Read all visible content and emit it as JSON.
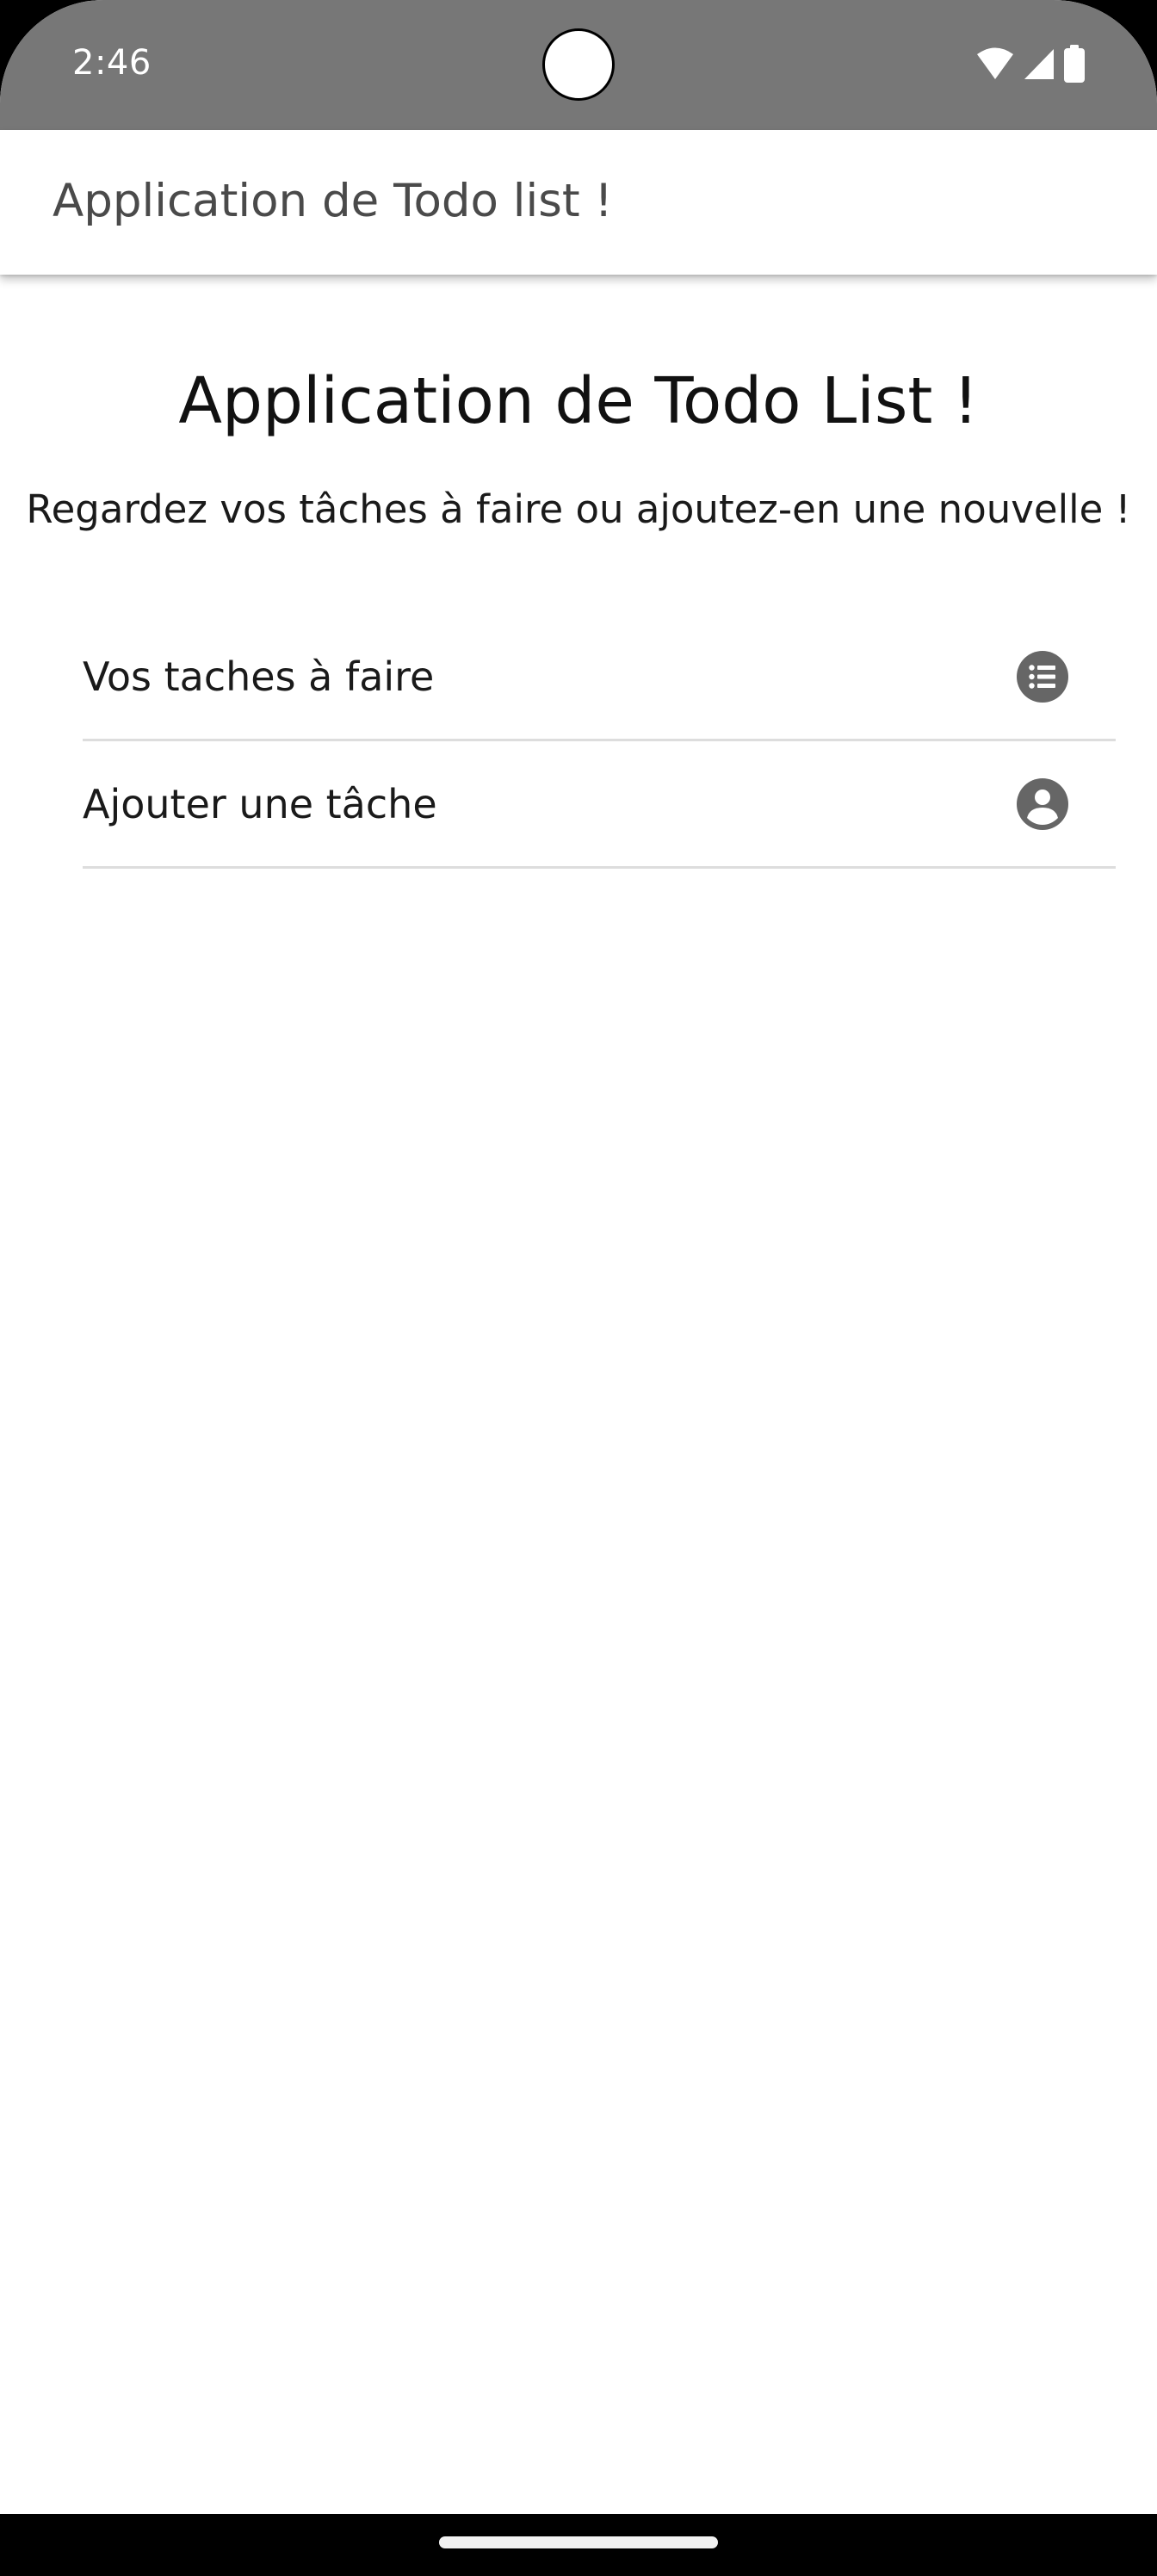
{
  "status_bar": {
    "time": "2:46",
    "icons": [
      "wifi-icon",
      "cellular-signal-icon",
      "battery-icon"
    ]
  },
  "app_bar": {
    "title": "Application de Todo list !"
  },
  "main": {
    "title": "Application de Todo List !",
    "subtitle": "Regardez vos tâches à faire ou ajoutez-en une nouvelle !",
    "menu_items": [
      {
        "label": "Vos taches à faire",
        "icon": "list-icon"
      },
      {
        "label": "Ajouter une tâche",
        "icon": "account-circle-icon"
      }
    ]
  },
  "colors": {
    "status_bar": "#777777",
    "icon": "#666666",
    "divider": "#dddddd"
  }
}
